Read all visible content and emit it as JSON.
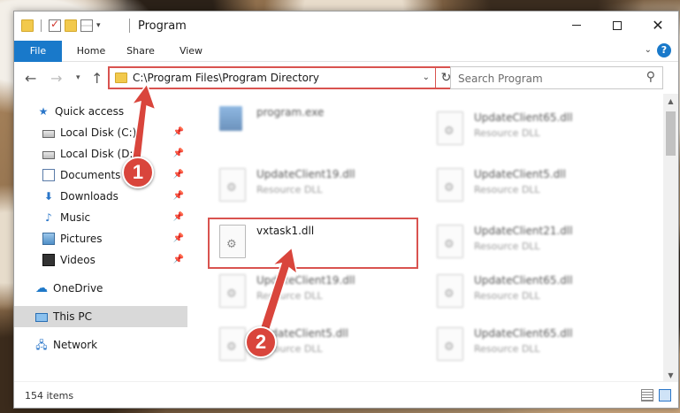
{
  "window": {
    "title": "Program",
    "minimize_icon": "minimize-icon",
    "maximize_icon": "maximize-icon",
    "close_glyph": "✕"
  },
  "ribbon": {
    "tabs": [
      {
        "label": "File"
      },
      {
        "label": "Home"
      },
      {
        "label": "Share"
      },
      {
        "label": "View"
      }
    ]
  },
  "address_bar": {
    "path": "C:\\Program Files\\Program Directory",
    "refresh_glyph": "↻"
  },
  "search": {
    "placeholder": "Search Program",
    "icon_glyph": "⚲"
  },
  "sidebar": {
    "items": [
      {
        "label": "Quick access"
      },
      {
        "label": "Local Disk (C:)"
      },
      {
        "label": "Local Disk (D:)"
      },
      {
        "label": "Documents"
      },
      {
        "label": "Downloads"
      },
      {
        "label": "Music"
      },
      {
        "label": "Pictures"
      },
      {
        "label": "Videos"
      },
      {
        "label": "OneDrive"
      },
      {
        "label": "This PC"
      },
      {
        "label": "Network"
      }
    ]
  },
  "files": [
    {
      "name": "program.exe",
      "desc": ""
    },
    {
      "name": "UpdateClient65.dll",
      "desc": "Resource DLL"
    },
    {
      "name": "UpdateClient19.dll",
      "desc": "Resource DLL"
    },
    {
      "name": "UpdateClient5.dll",
      "desc": "Resource DLL"
    },
    {
      "name": "vxtask1.dll",
      "desc": ""
    },
    {
      "name": "UpdateClient21.dll",
      "desc": "Resource DLL"
    },
    {
      "name": "UpdateClient19.dll",
      "desc": "Resource DLL"
    },
    {
      "name": "UpdateClient65.dll",
      "desc": "Resource DLL"
    },
    {
      "name": "UpdateClient5.dll",
      "desc": "Resource DLL"
    },
    {
      "name": "UpdateClient65.dll",
      "desc": "Resource DLL"
    }
  ],
  "status": {
    "item_count": "154 items"
  },
  "annotations": {
    "step1": "1",
    "step2": "2",
    "highlight_color": "#d9534f"
  }
}
